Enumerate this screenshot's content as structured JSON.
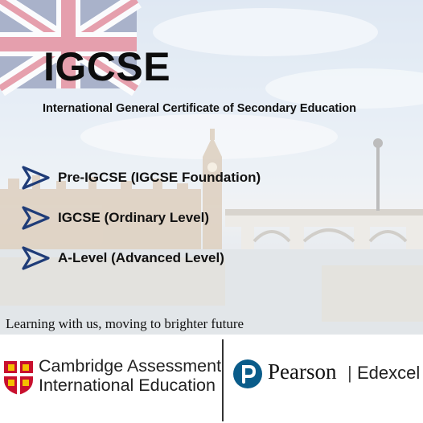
{
  "header": {
    "title": "IGCSE",
    "subtitle": "International General Certificate of Secondary Education"
  },
  "programs": [
    {
      "label": "Pre-IGCSE (IGCSE Foundation)",
      "icon": "chevron-right-icon"
    },
    {
      "label": "IGCSE (Ordinary Level)",
      "icon": "chevron-right-icon"
    },
    {
      "label": "A-Level (Advanced Level)",
      "icon": "chevron-right-icon"
    }
  ],
  "tagline": "Learning with us, moving to brighter future",
  "footer": {
    "cambridge_line1": "Cambridge Assessment",
    "cambridge_line2": "International Education",
    "pearson": "Pearson",
    "separator": "|",
    "edexcel": "Edexcel"
  },
  "colors": {
    "chevron": "#1f3c78",
    "cambridge_red": "#c8102e",
    "pearson_blue": "#0a5c8a"
  }
}
